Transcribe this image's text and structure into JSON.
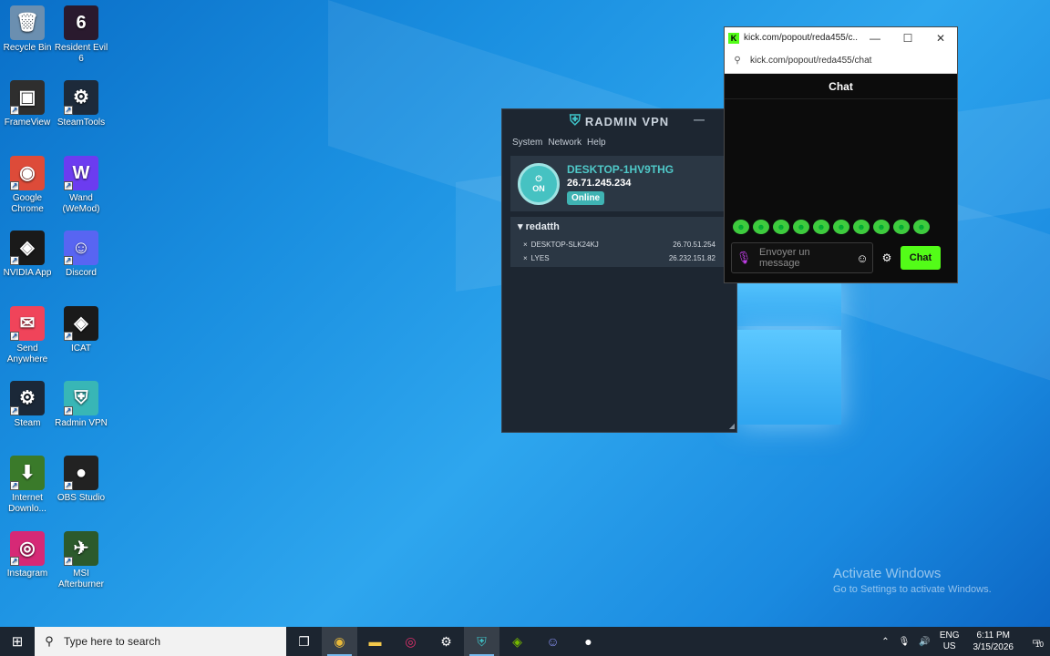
{
  "desktop_icons": [
    {
      "label": "Recycle Bin",
      "icon": "recycle-bin-icon",
      "color": "#6b8fb0",
      "glyph": "🗑"
    },
    {
      "label": "Resident Evil 6",
      "icon": "resident-evil-icon",
      "color": "#2a1a2e",
      "glyph": "6"
    },
    {
      "label": "FrameView",
      "icon": "frameview-icon",
      "color": "#2e2e2e",
      "glyph": "▣"
    },
    {
      "label": "SteamTools",
      "icon": "steamtools-icon",
      "color": "#1d2a3a",
      "glyph": "⚙"
    },
    {
      "label": "Google Chrome",
      "icon": "chrome-icon",
      "color": "#dd4b39",
      "glyph": "◉"
    },
    {
      "label": "Wand (WeMod)",
      "icon": "wand-icon",
      "color": "#6c3cf0",
      "glyph": "W"
    },
    {
      "label": "NVIDIA App",
      "icon": "nvidia-icon",
      "color": "#1a1a1a",
      "glyph": "◈"
    },
    {
      "label": "Discord",
      "icon": "discord-icon",
      "color": "#5865f2",
      "glyph": "☺"
    },
    {
      "label": "Send Anywhere",
      "icon": "send-anywhere-icon",
      "color": "#f0445a",
      "glyph": "✉"
    },
    {
      "label": "ICAT",
      "icon": "icat-icon",
      "color": "#1a1a1a",
      "glyph": "◈"
    },
    {
      "label": "Steam",
      "icon": "steam-icon",
      "color": "#1b2838",
      "glyph": "⚙"
    },
    {
      "label": "Radmin VPN",
      "icon": "radmin-vpn-icon",
      "color": "#38b6b6",
      "glyph": "⛨"
    },
    {
      "label": "Internet Downlo...",
      "icon": "idm-icon",
      "color": "#3a7a2a",
      "glyph": "⬇"
    },
    {
      "label": "OBS Studio",
      "icon": "obs-icon",
      "color": "#222222",
      "glyph": "●"
    },
    {
      "label": "Instagram",
      "icon": "instagram-icon",
      "color": "#d62976",
      "glyph": "◎"
    },
    {
      "label": "MSI Afterburner",
      "icon": "msi-afterburner-icon",
      "color": "#2c5a2c",
      "glyph": "✈"
    }
  ],
  "radmin": {
    "title": "RADMIN VPN",
    "menu": [
      "System",
      "Network",
      "Help"
    ],
    "power_label": "ON",
    "hostname": "DESKTOP-1HV9THG",
    "ip": "26.71.245.234",
    "status": "Online",
    "network_name": "redatth",
    "peers": [
      {
        "name": "DESKTOP-SLK24KJ",
        "ip": "26.70.51.254"
      },
      {
        "name": "LYES",
        "ip": "26.232.151.82"
      }
    ]
  },
  "chat_window": {
    "tab_title": "kick.com/popout/reda455/c...",
    "url": "kick.com/popout/reda455/chat",
    "header": "Chat",
    "placeholder": "Envoyer un message",
    "send_label": "Chat",
    "accent": "#53fc18"
  },
  "activation": {
    "line1": "Activate Windows",
    "line2": "Go to Settings to activate Windows."
  },
  "taskbar": {
    "search_placeholder": "Type here to search",
    "apps": [
      "task-view-icon",
      "chrome-icon",
      "file-explorer-icon",
      "instagram-icon",
      "steam-icon",
      "radmin-vpn-icon",
      "nvidia-icon",
      "discord-icon",
      "obs-icon"
    ],
    "lang": "ENG",
    "region": "US",
    "time": "6:11 PM",
    "date": "3/15/2026",
    "notification_count": "10"
  }
}
